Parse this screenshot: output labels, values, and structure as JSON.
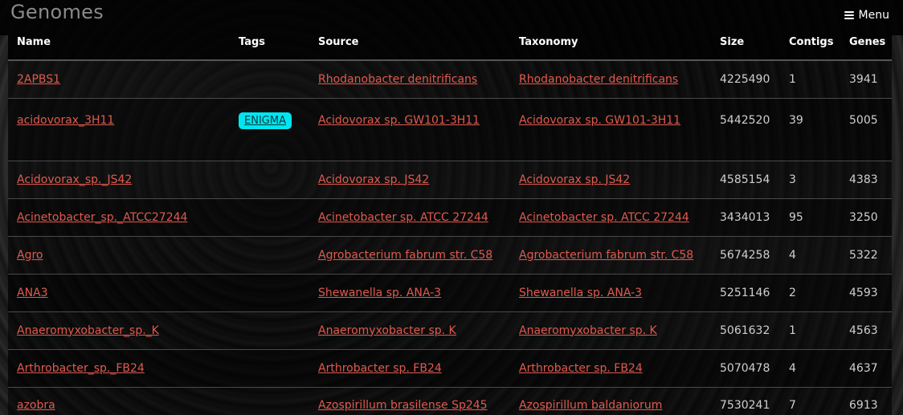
{
  "header": {
    "title": "Genomes",
    "menu_label": "Menu"
  },
  "table": {
    "columns": [
      "Name",
      "Tags",
      "Source",
      "Taxonomy",
      "Size",
      "Contigs",
      "Genes"
    ],
    "rows": [
      {
        "name": "2APBS1",
        "tag": "",
        "source": "Rhodanobacter denitrificans",
        "taxonomy": "Rhodanobacter denitrificans",
        "size": "4225490",
        "contigs": "1",
        "genes": "3941"
      },
      {
        "name": "acidovorax_3H11",
        "tag": "ENIGMA",
        "source": "Acidovorax sp. GW101-3H11",
        "taxonomy": "Acidovorax sp. GW101-3H11",
        "size": "5442520",
        "contigs": "39",
        "genes": "5005"
      },
      {
        "name": "Acidovorax_sp._JS42",
        "tag": "",
        "source": "Acidovorax sp. JS42",
        "taxonomy": "Acidovorax sp. JS42",
        "size": "4585154",
        "contigs": "3",
        "genes": "4383"
      },
      {
        "name": "Acinetobacter_sp._ATCC27244",
        "tag": "",
        "source": "Acinetobacter sp. ATCC 27244",
        "taxonomy": "Acinetobacter sp. ATCC 27244",
        "size": "3434013",
        "contigs": "95",
        "genes": "3250"
      },
      {
        "name": "Agro",
        "tag": "",
        "source": "Agrobacterium fabrum str. C58",
        "taxonomy": "Agrobacterium fabrum str. C58",
        "size": "5674258",
        "contigs": "4",
        "genes": "5322"
      },
      {
        "name": "ANA3",
        "tag": "",
        "source": "Shewanella sp. ANA-3",
        "taxonomy": "Shewanella sp. ANA-3",
        "size": "5251146",
        "contigs": "2",
        "genes": "4593"
      },
      {
        "name": "Anaeromyxobacter_sp._K",
        "tag": "",
        "source": "Anaeromyxobacter sp. K",
        "taxonomy": "Anaeromyxobacter sp. K",
        "size": "5061632",
        "contigs": "1",
        "genes": "4563"
      },
      {
        "name": "Arthrobacter_sp._FB24",
        "tag": "",
        "source": "Arthrobacter sp. FB24",
        "taxonomy": "Arthrobacter sp. FB24",
        "size": "5070478",
        "contigs": "4",
        "genes": "4637"
      },
      {
        "name": "azobra",
        "tag": "",
        "source": "Azospirillum brasilense Sp245",
        "taxonomy": "Azospirillum baldaniorum",
        "size": "7530241",
        "contigs": "7",
        "genes": "6913"
      }
    ]
  },
  "colors": {
    "link": "#e05a4e",
    "tag_bg": "#00e5ef",
    "header_bg": "#000000"
  }
}
